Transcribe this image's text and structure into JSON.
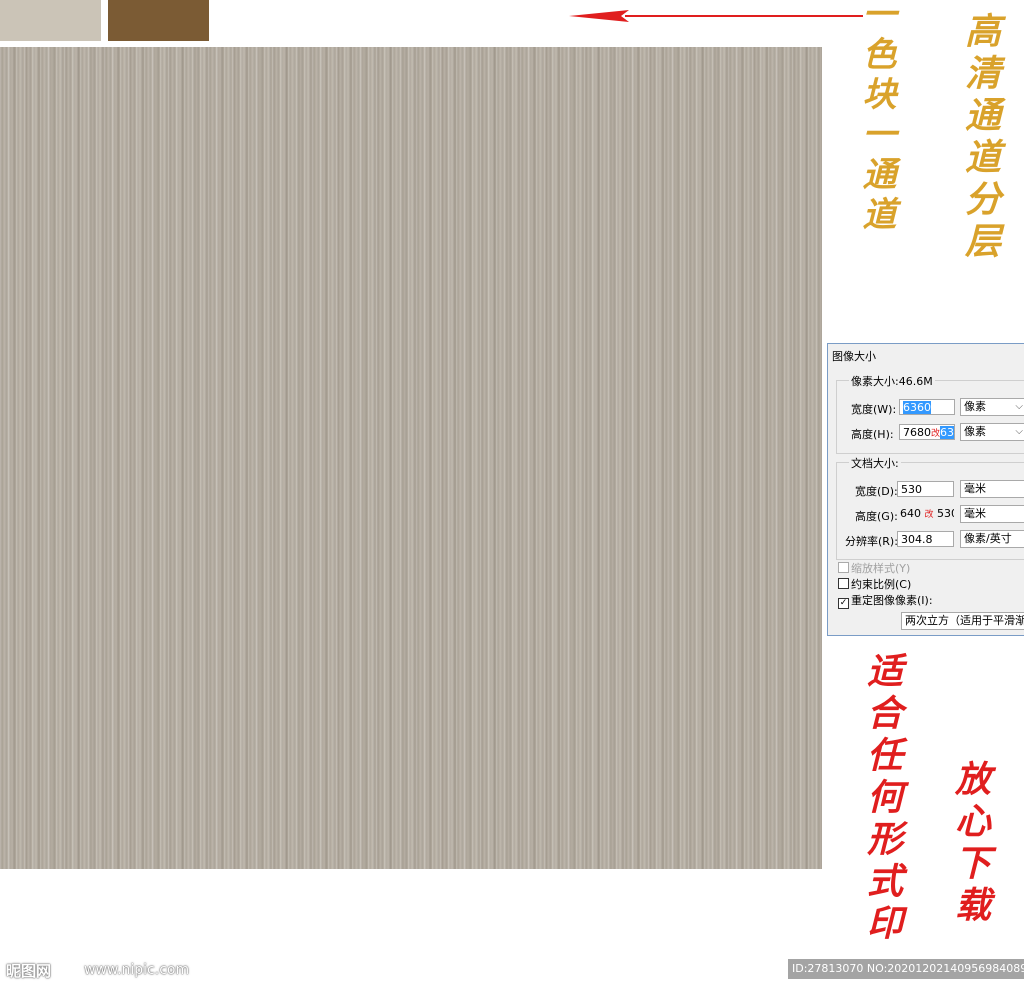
{
  "colors": {
    "swatch_light": "#cbc4b7",
    "swatch_dark": "#7b5b34",
    "texture_base": "#b4aca0",
    "gold_text": "#d9a22b",
    "red_text": "#e01e1e",
    "arrow": "#e01e1e",
    "selection": "#3399ff"
  },
  "annotations": {
    "left_gold": "一色块一通道",
    "right_gold": "高清通道分层",
    "left_red": "适合任何形式印",
    "right_red": "放心下载"
  },
  "dialog": {
    "title": "图像大小",
    "pixel_group": {
      "title": "像素大小:46.6M",
      "width_label": "宽度(W):",
      "width_value": "6360",
      "width_unit": "像素",
      "height_label": "高度(H):",
      "height_value_old": "7680",
      "height_change_mark": "改",
      "height_value_new": "6360",
      "height_unit": "像素"
    },
    "doc_group": {
      "title": "文档大小:",
      "width_label": "宽度(D):",
      "width_value": "530",
      "width_unit": "毫米",
      "height_label": "高度(G):",
      "height_value_old": "640",
      "height_change_mark": "改",
      "height_value_new": "530",
      "height_unit": "毫米",
      "resolution_label": "分辨率(R):",
      "resolution_value": "304.8",
      "resolution_unit": "像素/英寸"
    },
    "scale_styles_label": "缩放样式(Y)",
    "constrain_label": "约束比例(C)",
    "resample_label": "重定图像像素(I):",
    "resample_method": "两次立方（适用于平滑渐变"
  },
  "watermark": {
    "logo": "昵图网",
    "url": "www.nipic.com",
    "id_text": "ID:27813070 NO:20201202140956984089"
  }
}
